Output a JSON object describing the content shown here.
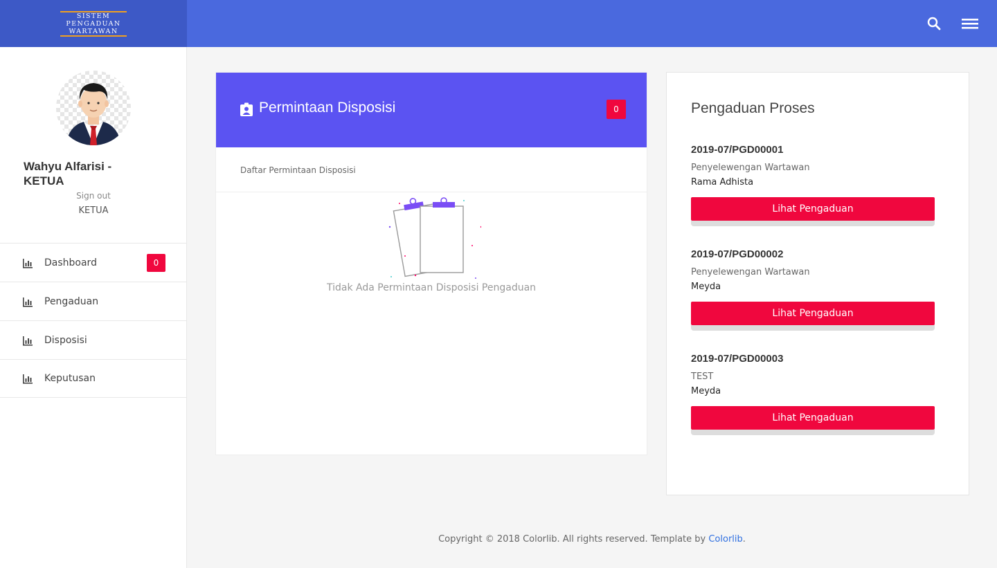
{
  "app": {
    "logo_lines": [
      "SISTEM",
      "PENGADUAN",
      "WARTAWAN"
    ]
  },
  "topbar": {
    "icons": [
      "search-icon",
      "menu-icon"
    ]
  },
  "user": {
    "name": "Wahyu Alfarisi - KETUA",
    "sign_out": "Sign out",
    "role": "KETUA"
  },
  "sidebar": {
    "items": [
      {
        "label": "Dashboard",
        "badge": "0",
        "icon": "bar-chart-icon"
      },
      {
        "label": "Pengaduan",
        "icon": "bar-chart-icon"
      },
      {
        "label": "Disposisi",
        "icon": "bar-chart-icon"
      },
      {
        "label": "Keputusan",
        "icon": "bar-chart-icon"
      }
    ]
  },
  "main": {
    "title": "Permintaan Disposisi",
    "badge": "0",
    "subtitle": "Daftar Permintaan Disposisi",
    "empty_text": "Tidak Ada Permintaan Disposisi Pengaduan"
  },
  "panel": {
    "title": "Pengaduan Proses",
    "items": [
      {
        "code": "2019-07/PGD00001",
        "category": "Penyelewengan Wartawan",
        "reporter": "Rama Adhista",
        "button": "Lihat Pengaduan"
      },
      {
        "code": "2019-07/PGD00002",
        "category": "Penyelewengan Wartawan",
        "reporter": "Meyda",
        "button": "Lihat Pengaduan"
      },
      {
        "code": "2019-07/PGD00003",
        "category": "TEST",
        "reporter": "Meyda",
        "button": "Lihat Pengaduan"
      }
    ]
  },
  "footer": {
    "text": "Copyright © 2018 Colorlib. All rights reserved. Template by ",
    "link": "Colorlib",
    "suffix": "."
  },
  "colors": {
    "topbar": "#4a69de",
    "brand": "#3d59c6",
    "card_header": "#5b53f2",
    "accent_red": "#f0073e"
  }
}
